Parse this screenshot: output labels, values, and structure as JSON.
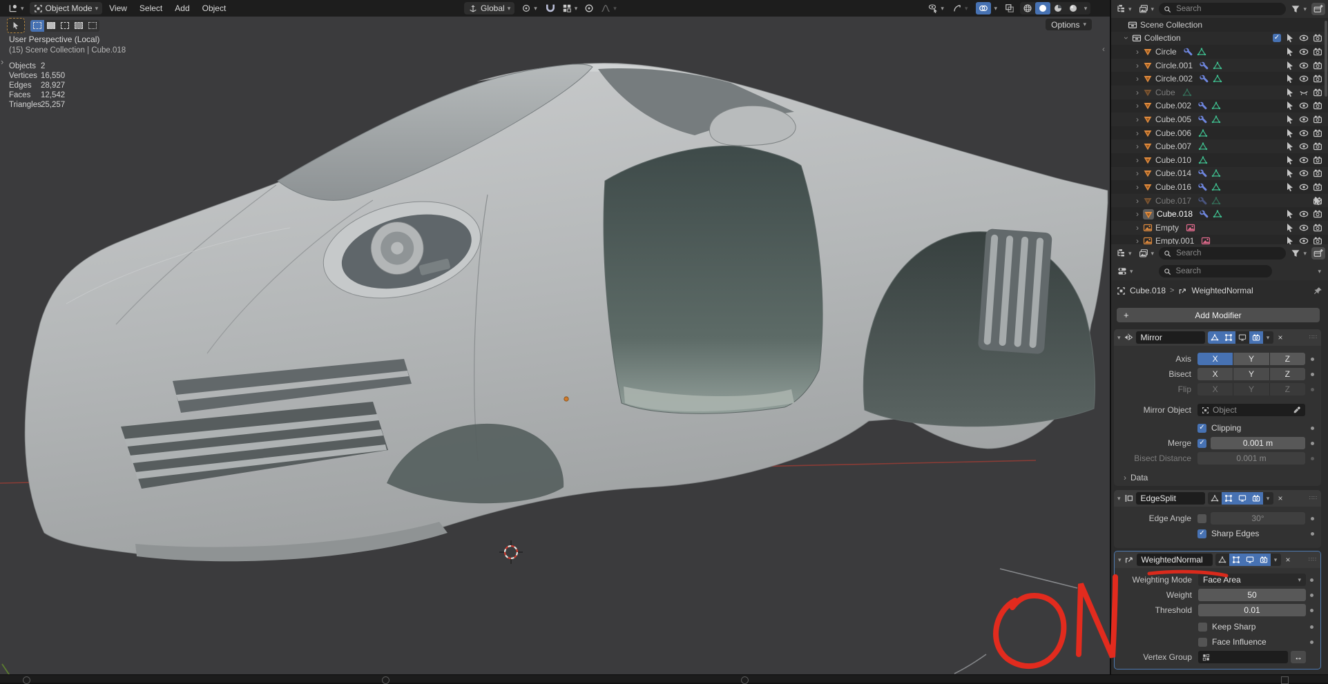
{
  "viewport": {
    "header": {
      "mode": "Object Mode",
      "menus": [
        "View",
        "Select",
        "Add",
        "Object"
      ],
      "orientation": "Global",
      "options_label": "Options"
    },
    "overlay": {
      "view_label": "User Perspective (Local)",
      "context_label": "(15) Scene Collection | Cube.018",
      "stats": [
        {
          "label": "Objects",
          "value": "2"
        },
        {
          "label": "Vertices",
          "value": "16,550"
        },
        {
          "label": "Edges",
          "value": "28,927"
        },
        {
          "label": "Faces",
          "value": "12,542"
        },
        {
          "label": "Triangles",
          "value": "25,257"
        }
      ]
    },
    "annotation": {
      "text": "ON",
      "color": "#e22b1e"
    }
  },
  "outliner": {
    "search_placeholder": "Search",
    "rows": [
      {
        "name": "Scene Collection",
        "type": "scene-collection"
      },
      {
        "name": "Collection",
        "type": "collection",
        "checkbox": true,
        "eye": "open"
      },
      {
        "name": "Circle",
        "type": "mesh",
        "wrench": true,
        "meshdata": true,
        "eye": "open"
      },
      {
        "name": "Circle.001",
        "type": "mesh",
        "wrench": true,
        "meshdata": true,
        "eye": "open"
      },
      {
        "name": "Circle.002",
        "type": "mesh",
        "wrench": true,
        "meshdata": true,
        "eye": "open"
      },
      {
        "name": "Cube",
        "type": "mesh",
        "wrench": false,
        "meshdata": true,
        "eye": "closed",
        "grayed": true
      },
      {
        "name": "Cube.002",
        "type": "mesh",
        "wrench": true,
        "meshdata": true,
        "eye": "open"
      },
      {
        "name": "Cube.005",
        "type": "mesh",
        "wrench": true,
        "meshdata": true,
        "eye": "open"
      },
      {
        "name": "Cube.006",
        "type": "mesh",
        "wrench": false,
        "meshdata": true,
        "eye": "open"
      },
      {
        "name": "Cube.007",
        "type": "mesh",
        "wrench": false,
        "meshdata": true,
        "eye": "open"
      },
      {
        "name": "Cube.010",
        "type": "mesh",
        "wrench": false,
        "meshdata": true,
        "eye": "open"
      },
      {
        "name": "Cube.014",
        "type": "mesh",
        "wrench": true,
        "meshdata": true,
        "eye": "open"
      },
      {
        "name": "Cube.016",
        "type": "mesh",
        "wrench": true,
        "meshdata": true,
        "eye": "open"
      },
      {
        "name": "Cube.017",
        "type": "mesh",
        "wrench": true,
        "meshdata": true,
        "eye": "closed",
        "grayed": true
      },
      {
        "name": "Cube.018",
        "type": "mesh",
        "wrench": true,
        "meshdata": true,
        "eye": "open",
        "selected": true
      },
      {
        "name": "Empty",
        "type": "empty-image",
        "eye": "open"
      },
      {
        "name": "Empty.001",
        "type": "empty-image",
        "eye": "open",
        "clipped": true
      }
    ]
  },
  "properties": {
    "search_placeholder": "Search",
    "breadcrumb": {
      "object": "Cube.018",
      "separator": ">",
      "modifier": "WeightedNormal"
    },
    "add_modifier_label": "Add Modifier",
    "mirror": {
      "name": "Mirror",
      "axis_label": "Axis",
      "bisect_label": "Bisect",
      "flip_label": "Flip",
      "axis_buttons": [
        "X",
        "Y",
        "Z"
      ],
      "axis_active": "X",
      "mirror_object_label": "Mirror Object",
      "object_placeholder": "Object",
      "clipping_label": "Clipping",
      "clipping_checked": true,
      "merge_label": "Merge",
      "merge_checked": true,
      "merge_value": "0.001 m",
      "bisect_distance_label": "Bisect Distance",
      "bisect_distance_value": "0.001 m",
      "data_label": "Data"
    },
    "edgesplit": {
      "name": "EdgeSplit",
      "edge_angle_label": "Edge Angle",
      "edge_angle_checked": false,
      "edge_angle_value": "30°",
      "sharp_edges_label": "Sharp Edges",
      "sharp_edges_checked": true
    },
    "weightednormal": {
      "name": "WeightedNormal",
      "weighting_mode_label": "Weighting Mode",
      "weighting_mode_value": "Face Area",
      "weight_label": "Weight",
      "weight_value": "50",
      "threshold_label": "Threshold",
      "threshold_value": "0.01",
      "keep_sharp_label": "Keep Sharp",
      "keep_sharp_checked": false,
      "face_influence_label": "Face Influence",
      "face_influence_checked": false,
      "vertex_group_label": "Vertex Group"
    }
  },
  "colors": {
    "accent": "#4772b3",
    "annotation_red": "#e22b1e",
    "mesh_object_orange": "#e08b3e",
    "mesh_data_green": "#3fbf8f",
    "modifier_wrench_blue": "#6f87e0",
    "axis_x_red": "#8e3c36"
  }
}
